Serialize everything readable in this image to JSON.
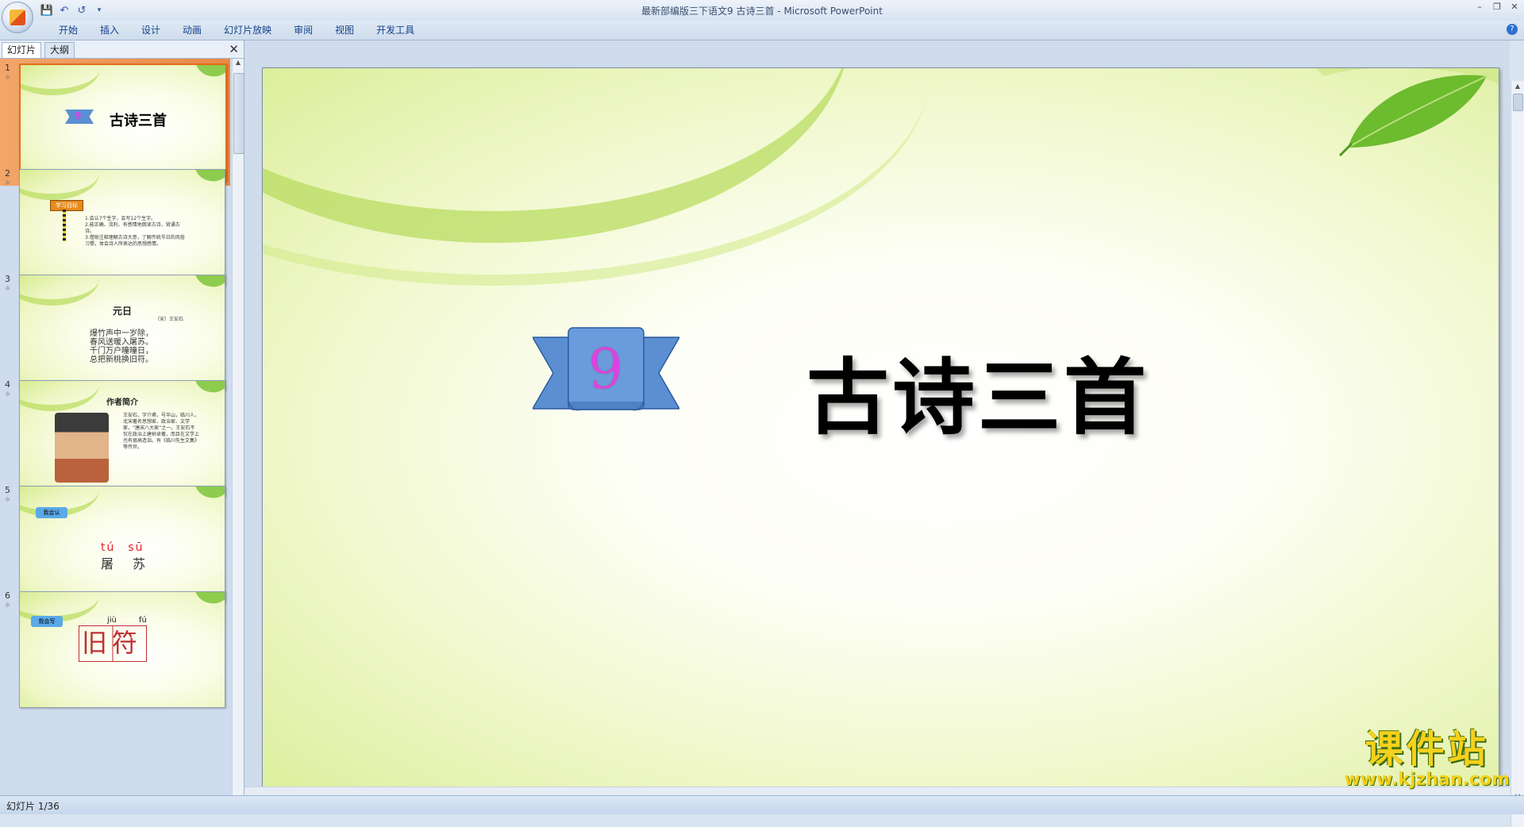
{
  "window": {
    "title": "最新部编版三下语文9 古诗三首 - Microsoft PowerPoint"
  },
  "quick_access": {
    "icons": [
      "save-icon",
      "undo-icon",
      "redo-icon",
      "customize-icon"
    ]
  },
  "ribbon": {
    "tabs": [
      "开始",
      "插入",
      "设计",
      "动画",
      "幻灯片放映",
      "审阅",
      "视图",
      "开发工具"
    ]
  },
  "panel": {
    "tabs": [
      "幻灯片",
      "大纲"
    ],
    "active_tab": "幻灯片"
  },
  "slides": [
    {
      "number": "1",
      "title": "古诗三首",
      "badge": "9"
    },
    {
      "number": "2",
      "sign": "学习目标",
      "lines": [
        "1.会认7个生字，会写12个生字。",
        "2.能正确、流利、有感情地朗读古诗，背诵古诗。",
        "3.借助注释理解古诗大意，了解传统节日的风俗习惯，体会诗人所表达的思想感情。"
      ]
    },
    {
      "number": "3",
      "title": "元日",
      "author": "（宋）王安石",
      "poem": [
        "爆竹声中一岁除，",
        "春风送暖入屠苏。",
        "千门万户曈曈日，",
        "总把新桃换旧符。"
      ]
    },
    {
      "number": "4",
      "title": "作者简介",
      "text": "王安石，字介甫，号半山，临川人，北宋著名思想家、政治家、文学家，“唐宋八大家”之一。王安石不仅在政治上建树卓著，而且在文学上也有很高造诣。有《临川先生文集》等传世。"
    },
    {
      "number": "5",
      "badge": "我会认",
      "pinyin": "tú　sū",
      "chars": "屠　苏"
    },
    {
      "number": "6",
      "badge": "我会写",
      "pinyin": [
        "jiù",
        "fú"
      ],
      "chars": "旧符"
    }
  ],
  "main_slide": {
    "badge_number": "9",
    "title": "古诗三首"
  },
  "status": {
    "text": "幻灯片 1/36"
  },
  "watermark": {
    "text": "课件站",
    "url": "www.kjzhan.com"
  },
  "colors": {
    "ribbon_blue": "#5b8fd2",
    "badge_magenta": "#e040e8",
    "selection_orange": "#e98a45"
  }
}
